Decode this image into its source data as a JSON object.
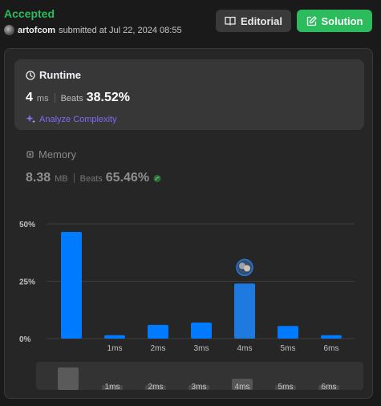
{
  "header": {
    "status": "Accepted",
    "username": "artofcom",
    "submitted_text": "submitted at Jul 22, 2024 08:55",
    "editorial_label": "Editorial",
    "solution_label": "Solution"
  },
  "runtime": {
    "title": "Runtime",
    "value": "4",
    "unit": "ms",
    "beats_label": "Beats",
    "beats_value": "38.52%",
    "analyze_label": "Analyze Complexity"
  },
  "memory": {
    "title": "Memory",
    "value": "8.38",
    "unit": "MB",
    "beats_label": "Beats",
    "beats_value": "65.46%"
  },
  "colors": {
    "accent_green": "#2cbb5d",
    "bar_blue": "#007aff",
    "analyze_purple": "#7c6cf2"
  },
  "chart_data": {
    "type": "bar",
    "categories": [
      "",
      "1ms",
      "2ms",
      "3ms",
      "4ms",
      "5ms",
      "6ms"
    ],
    "values": [
      46.5,
      1.5,
      6,
      7,
      24,
      5.5,
      1.5
    ],
    "y_ticks": [
      "50%",
      "25%",
      "0%"
    ],
    "ylim": [
      0,
      50
    ],
    "highlight_category": "4ms",
    "grid": true,
    "minimap_labels": [
      "1ms",
      "2ms",
      "3ms",
      "4ms",
      "5ms",
      "6ms"
    ]
  }
}
